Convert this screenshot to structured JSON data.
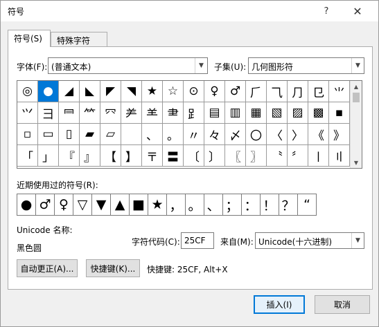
{
  "window": {
    "title": "符号",
    "help_glyph": "?",
    "close_glyph": "✕"
  },
  "tabs": [
    {
      "label": "符号(S)",
      "active": true
    },
    {
      "label": "特殊字符(P)",
      "active": false
    }
  ],
  "font": {
    "label": "字体(F):",
    "value": "(普通文本)"
  },
  "subset": {
    "label": "子集(U):",
    "value": "几何图形符"
  },
  "symbols": [
    "◎",
    "●",
    "◢",
    "◣",
    "◤",
    "◥",
    "★",
    "☆",
    "⊙",
    "♀",
    "♂",
    "⺁",
    "⺄",
    "⺆",
    "⺋",
    "⺌",
    "⺍",
    "⺕",
    "⺜",
    "⺮",
    "⺳",
    "⺶",
    "⺷",
    "⺻",
    "⻊",
    "▤",
    "▥",
    "▦",
    "▧",
    "▨",
    "▩",
    "▪",
    "▫",
    "▭",
    "▯",
    "▰",
    "▱",
    "",
    "、",
    "。",
    "〃",
    "々",
    "〆",
    "〇",
    "〈",
    "〉",
    "《",
    "》",
    "「",
    "」",
    "『",
    "』",
    "【",
    "】",
    "〒",
    "〓",
    "〔",
    "〕",
    "〖",
    "〗",
    "〝",
    "〞",
    "〡",
    "〢"
  ],
  "selected_index": 1,
  "recent": {
    "label": "近期使用过的符号(R):",
    "items": [
      "●",
      "♂",
      "♀",
      "▽",
      "▼",
      "▲",
      "■",
      "★",
      "，",
      "。",
      "、",
      "；",
      "：",
      "！",
      "？",
      "“"
    ]
  },
  "unicode_name": {
    "label": "Unicode 名称:",
    "value": "黑色圆"
  },
  "char_code": {
    "label": "字符代码(C):",
    "value": "25CF"
  },
  "from": {
    "label": "来自(M):",
    "value": "Unicode(十六进制)"
  },
  "buttons": {
    "autocorrect": "自动更正(A)...",
    "shortcut_key": "快捷键(K)...",
    "insert": "插入(I)",
    "cancel": "取消"
  },
  "shortcut_text": "快捷键: 25CF, Alt+X"
}
